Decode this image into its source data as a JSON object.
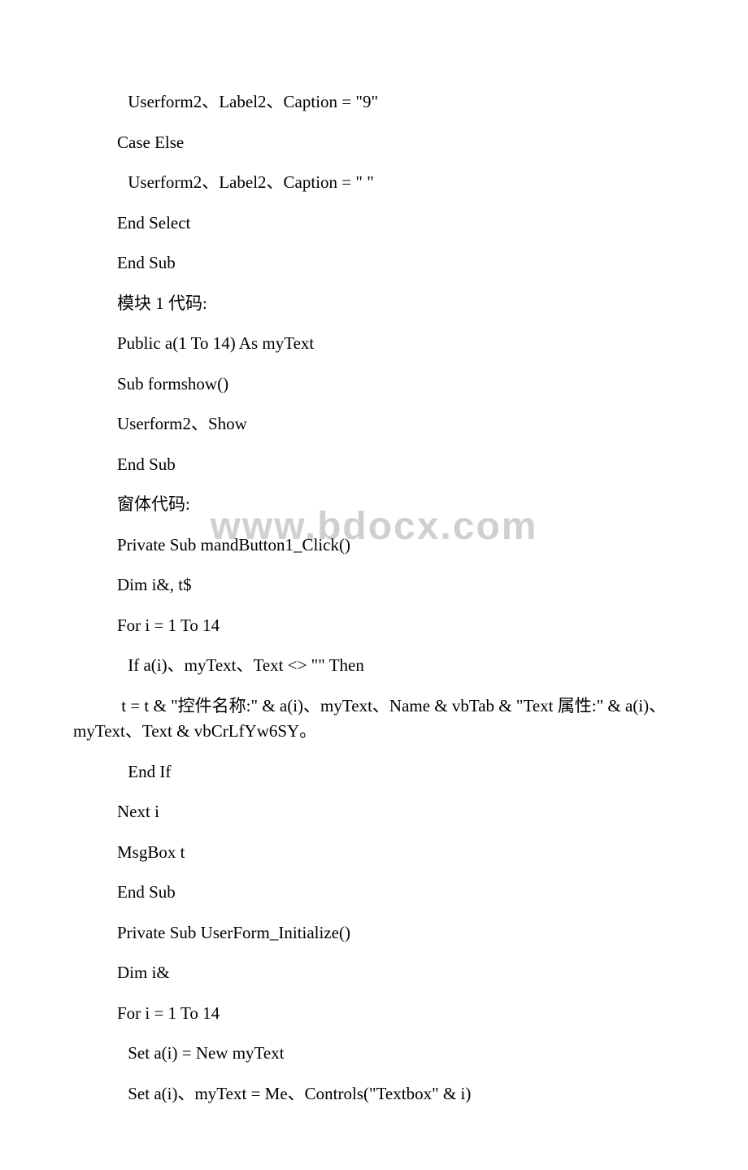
{
  "watermark": "www.bdocx.com",
  "lines": [
    {
      "indent": "indent2",
      "text": " Userform2、Label2、Caption = \"9\""
    },
    {
      "indent": "indent1",
      "text": "Case Else"
    },
    {
      "indent": "indent2",
      "text": " Userform2、Label2、Caption = \" \""
    },
    {
      "indent": "indent1",
      "text": "End Select"
    },
    {
      "indent": "indent1",
      "text": "End Sub"
    },
    {
      "indent": "indent1",
      "text": "模块 1 代码:"
    },
    {
      "indent": "indent1",
      "text": "Public a(1 To 14) As myText"
    },
    {
      "indent": "indent1",
      "text": "Sub formshow()"
    },
    {
      "indent": "indent1",
      "text": "Userform2、Show"
    },
    {
      "indent": "indent1",
      "text": "End Sub"
    },
    {
      "indent": "indent1",
      "text": "窗体代码:"
    },
    {
      "indent": "indent1",
      "text": "Private Sub mandButton1_Click()"
    },
    {
      "indent": "indent1",
      "text": "Dim i&, t$"
    },
    {
      "indent": "indent1",
      "text": "For i = 1 To 14"
    },
    {
      "indent": "indent2",
      "text": " If a(i)、myText、Text <> \"\" Then"
    },
    {
      "indent": "indent1",
      "text": " t = t & \"控件名称:\" & a(i)、myText、Name & vbTab & \"Text 属性:\" & a(i)、myText、Text & vbCrLfYw6SY。",
      "wrap": true
    },
    {
      "indent": "indent2",
      "text": " End If"
    },
    {
      "indent": "indent1",
      "text": "Next i"
    },
    {
      "indent": "indent1",
      "text": "MsgBox t"
    },
    {
      "indent": "indent1",
      "text": "End Sub"
    },
    {
      "indent": "indent1",
      "text": "Private Sub UserForm_Initialize()"
    },
    {
      "indent": "indent1",
      "text": "Dim i&"
    },
    {
      "indent": "indent1",
      "text": "For i = 1 To 14"
    },
    {
      "indent": "indent2",
      "text": " Set a(i) = New myText"
    },
    {
      "indent": "indent2",
      "text": " Set a(i)、myText = Me、Controls(\"Textbox\" & i)"
    }
  ]
}
